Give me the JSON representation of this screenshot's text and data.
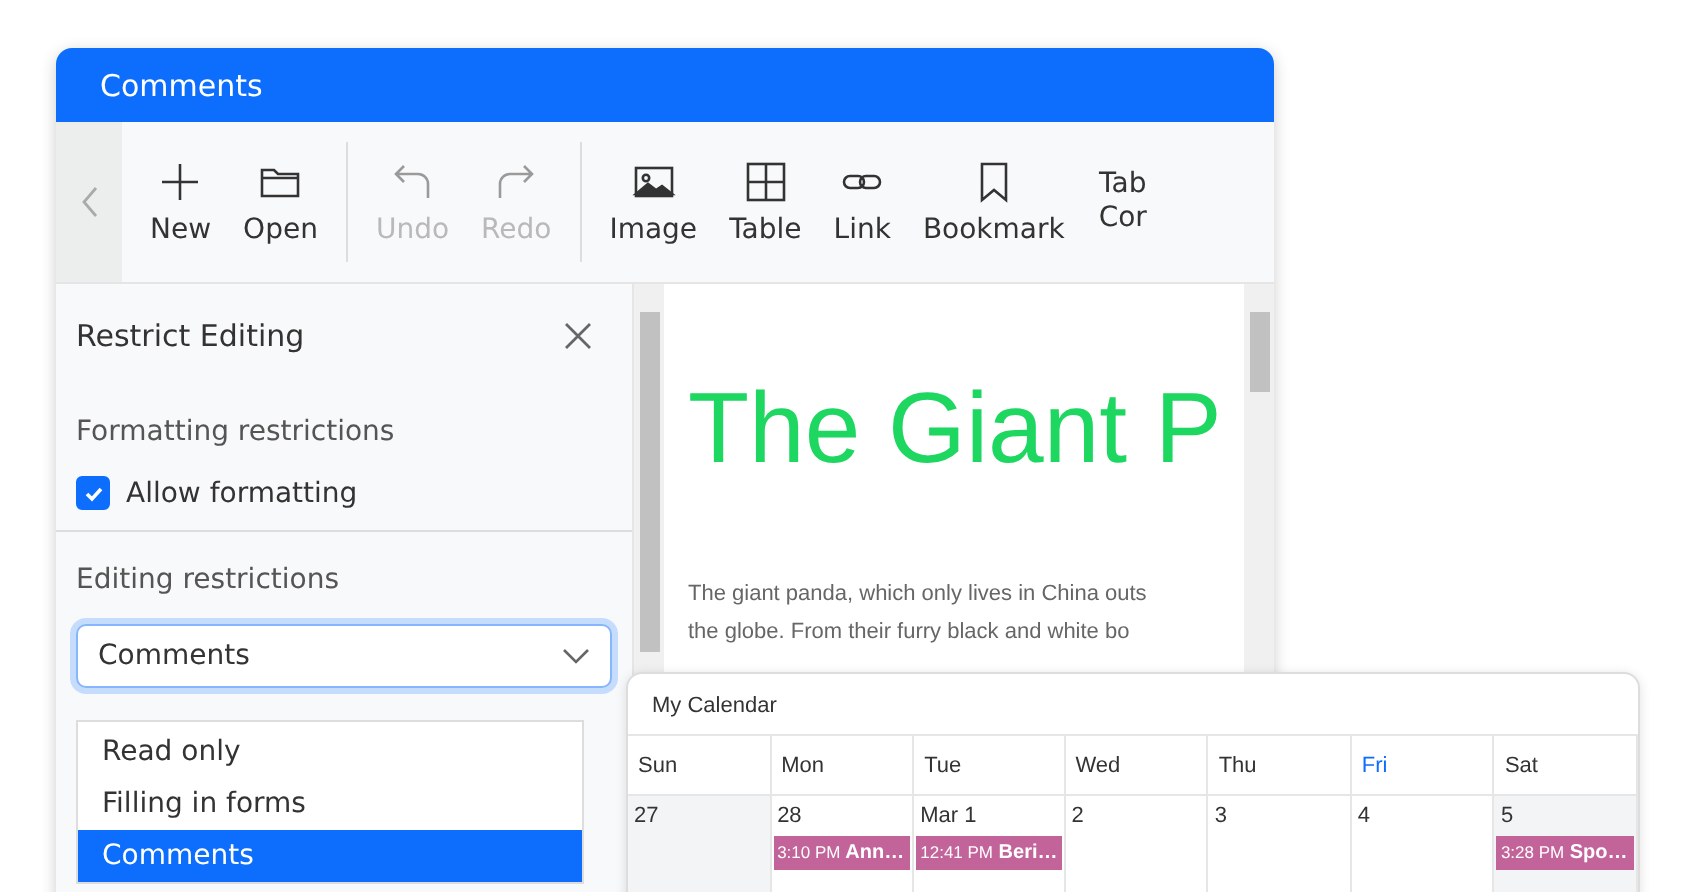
{
  "window": {
    "title": "Comments"
  },
  "toolbar": {
    "groups": [
      [
        {
          "label": "New",
          "disabled": false
        },
        {
          "label": "Open",
          "disabled": false
        }
      ],
      [
        {
          "label": "Undo",
          "disabled": true
        },
        {
          "label": "Redo",
          "disabled": true
        }
      ],
      [
        {
          "label": "Image",
          "disabled": false
        },
        {
          "label": "Table",
          "disabled": false
        },
        {
          "label": "Link",
          "disabled": false
        },
        {
          "label": "Bookmark",
          "disabled": false
        },
        {
          "label": "Tab Cor",
          "disabled": false
        }
      ]
    ]
  },
  "restrict_panel": {
    "title": "Restrict Editing",
    "formatting_heading": "Formatting restrictions",
    "allow_formatting": {
      "label": "Allow formatting",
      "checked": true
    },
    "editing_heading": "Editing restrictions",
    "select": {
      "value": "Comments",
      "expanded": true
    },
    "options": [
      {
        "label": "Read only",
        "selected": false
      },
      {
        "label": "Filling in forms",
        "selected": false
      },
      {
        "label": "Comments",
        "selected": true
      }
    ]
  },
  "document": {
    "heading": "The Giant P",
    "paragraph_lines": [
      "The giant panda, which only lives in China outs",
      "the globe. From their furry black and white bo"
    ]
  },
  "calendar": {
    "title": "My Calendar",
    "days": [
      {
        "label": "Sun",
        "selected": false
      },
      {
        "label": "Mon",
        "selected": false
      },
      {
        "label": "Tue",
        "selected": false
      },
      {
        "label": "Wed",
        "selected": false
      },
      {
        "label": "Thu",
        "selected": false
      },
      {
        "label": "Fri",
        "selected": true
      },
      {
        "label": "Sat",
        "selected": false
      }
    ],
    "cells": [
      {
        "date": "27",
        "weekend": true
      },
      {
        "date": "28",
        "weekend": false,
        "events": [
          {
            "time": "3:10 PM",
            "title": "Ann…",
            "color": "#c2639a"
          }
        ]
      },
      {
        "date": "Mar 1",
        "weekend": false,
        "events": [
          {
            "time": "12:41 PM",
            "title": "Beri…",
            "color": "#c2639a"
          }
        ]
      },
      {
        "date": "2",
        "weekend": false
      },
      {
        "date": "3",
        "weekend": false
      },
      {
        "date": "4",
        "weekend": false
      },
      {
        "date": "5",
        "weekend": true,
        "events": [
          {
            "time": "3:28 PM",
            "title": "Spo…",
            "color": "#c2639a"
          }
        ]
      }
    ]
  }
}
